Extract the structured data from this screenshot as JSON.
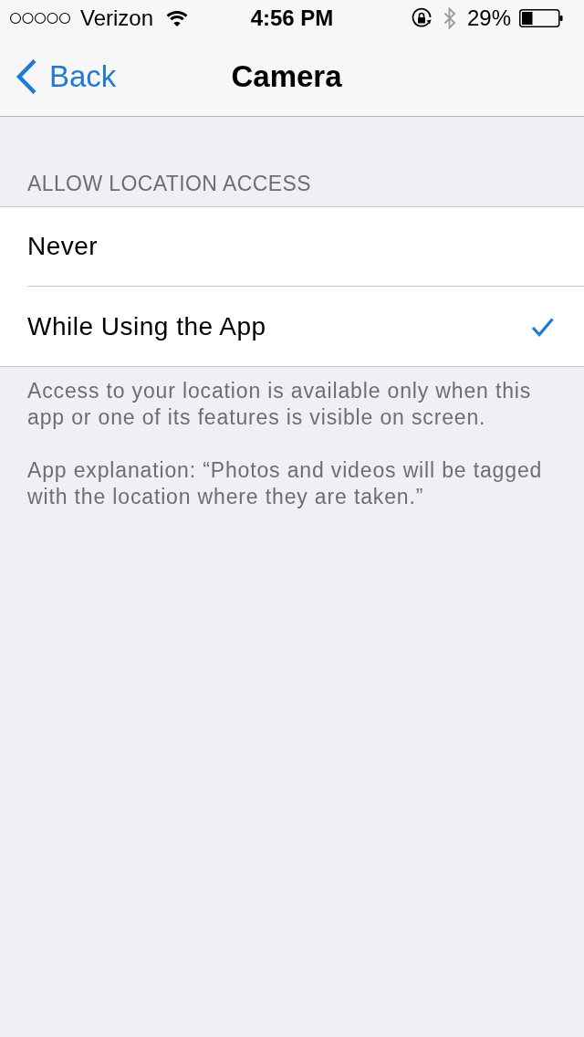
{
  "status_bar": {
    "carrier": "Verizon",
    "time": "4:56 PM",
    "battery": "29%"
  },
  "nav_bar": {
    "back": "Back",
    "title": "Camera"
  },
  "section": {
    "header": "ALLOW LOCATION ACCESS",
    "options": [
      {
        "label": "Never",
        "selected": false
      },
      {
        "label": "While Using the App",
        "selected": true
      }
    ],
    "footer": [
      "Access to your location is available only when this app or one of its features is visible on screen.",
      "App explanation: “Photos and videos will be tagged with the location where they are taken.”"
    ]
  }
}
